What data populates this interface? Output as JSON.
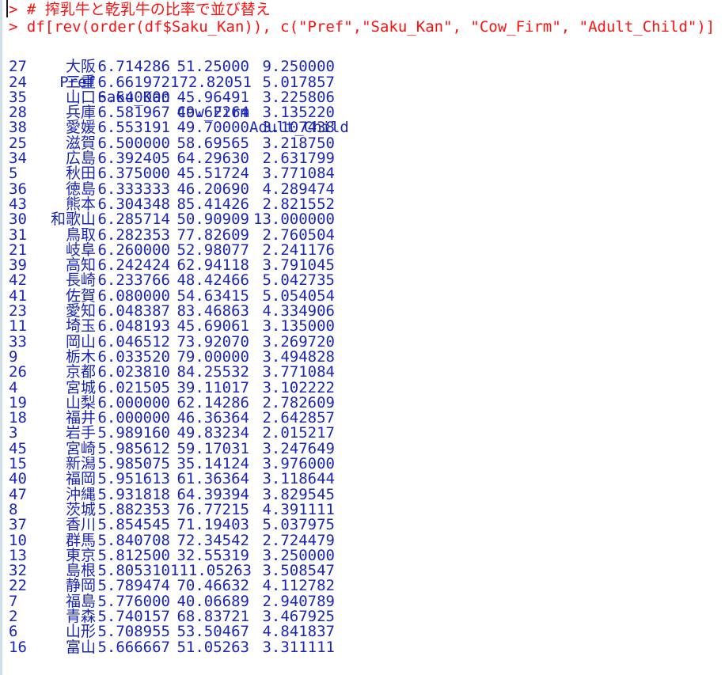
{
  "console": {
    "prompt_symbol": ">",
    "caret_visible": true,
    "colors": {
      "command": "#ff1111",
      "output": "#1a26b8",
      "background": "#ffffff",
      "frame_edge": "#cfe0ea"
    },
    "command_lines": [
      "> # 搾乳牛と乾乳牛の比率で並び替え",
      "> df[rev(order(df$Saku_Kan)), c(\"Pref\",\"Saku_Kan\", \"Cow_Firm\", \"Adult_Child\")]"
    ]
  },
  "table": {
    "columns": [
      "Pref",
      "Saku_Kan",
      "Cow_Firm",
      "Adult_Child"
    ],
    "rows": [
      {
        "idx": "27",
        "pref": "大阪",
        "saku": "6.714286",
        "cow": "51.25000",
        "ac": "9.250000"
      },
      {
        "idx": "24",
        "pref": "三重",
        "saku": "6.661972",
        "cow": "172.82051",
        "ac": "5.017857"
      },
      {
        "idx": "35",
        "pref": "山口",
        "saku": "6.640000",
        "cow": "45.96491",
        "ac": "3.225806"
      },
      {
        "idx": "28",
        "pref": "兵庫",
        "saku": "6.581967",
        "cow": "49.62264",
        "ac": "3.135220"
      },
      {
        "idx": "38",
        "pref": "愛媛",
        "saku": "6.553191",
        "cow": "49.70000",
        "ac": "3.107438"
      },
      {
        "idx": "25",
        "pref": "滋賀",
        "saku": "6.500000",
        "cow": "58.69565",
        "ac": "3.218750"
      },
      {
        "idx": "34",
        "pref": "広島",
        "saku": "6.392405",
        "cow": "64.29630",
        "ac": "2.631799"
      },
      {
        "idx": "5",
        "pref": "秋田",
        "saku": "6.375000",
        "cow": "45.51724",
        "ac": "3.771084"
      },
      {
        "idx": "36",
        "pref": "徳島",
        "saku": "6.333333",
        "cow": "46.20690",
        "ac": "4.289474"
      },
      {
        "idx": "43",
        "pref": "熊本",
        "saku": "6.304348",
        "cow": "85.41426",
        "ac": "2.821552"
      },
      {
        "idx": "30",
        "pref": "和歌山",
        "saku": "6.285714",
        "cow": "50.90909",
        "ac": "13.000000"
      },
      {
        "idx": "31",
        "pref": "鳥取",
        "saku": "6.282353",
        "cow": "77.82609",
        "ac": "2.760504"
      },
      {
        "idx": "21",
        "pref": "岐阜",
        "saku": "6.260000",
        "cow": "52.98077",
        "ac": "2.241176"
      },
      {
        "idx": "39",
        "pref": "高知",
        "saku": "6.242424",
        "cow": "62.94118",
        "ac": "3.791045"
      },
      {
        "idx": "42",
        "pref": "長崎",
        "saku": "6.233766",
        "cow": "48.42466",
        "ac": "5.042735"
      },
      {
        "idx": "41",
        "pref": "佐賀",
        "saku": "6.080000",
        "cow": "54.63415",
        "ac": "5.054054"
      },
      {
        "idx": "23",
        "pref": "愛知",
        "saku": "6.048387",
        "cow": "83.46863",
        "ac": "4.334906"
      },
      {
        "idx": "11",
        "pref": "埼玉",
        "saku": "6.048193",
        "cow": "45.69061",
        "ac": "3.135000"
      },
      {
        "idx": "33",
        "pref": "岡山",
        "saku": "6.046512",
        "cow": "73.92070",
        "ac": "3.269720"
      },
      {
        "idx": "9",
        "pref": "栃木",
        "saku": "6.033520",
        "cow": "79.00000",
        "ac": "3.494828"
      },
      {
        "idx": "26",
        "pref": "京都",
        "saku": "6.023810",
        "cow": "84.25532",
        "ac": "3.771084"
      },
      {
        "idx": "4",
        "pref": "宮城",
        "saku": "6.021505",
        "cow": "39.11017",
        "ac": "3.102222"
      },
      {
        "idx": "19",
        "pref": "山梨",
        "saku": "6.000000",
        "cow": "62.14286",
        "ac": "2.782609"
      },
      {
        "idx": "18",
        "pref": "福井",
        "saku": "6.000000",
        "cow": "46.36364",
        "ac": "2.642857"
      },
      {
        "idx": "3",
        "pref": "岩手",
        "saku": "5.989160",
        "cow": "49.83234",
        "ac": "2.015217"
      },
      {
        "idx": "45",
        "pref": "宮崎",
        "saku": "5.985612",
        "cow": "59.17031",
        "ac": "3.247649"
      },
      {
        "idx": "15",
        "pref": "新潟",
        "saku": "5.985075",
        "cow": "35.14124",
        "ac": "3.976000"
      },
      {
        "idx": "40",
        "pref": "福岡",
        "saku": "5.951613",
        "cow": "61.36364",
        "ac": "3.118644"
      },
      {
        "idx": "47",
        "pref": "沖縄",
        "saku": "5.931818",
        "cow": "64.39394",
        "ac": "3.829545"
      },
      {
        "idx": "8",
        "pref": "茨城",
        "saku": "5.882353",
        "cow": "76.77215",
        "ac": "4.391111"
      },
      {
        "idx": "37",
        "pref": "香川",
        "saku": "5.854545",
        "cow": "71.19403",
        "ac": "5.037975"
      },
      {
        "idx": "10",
        "pref": "群馬",
        "saku": "5.840708",
        "cow": "72.34542",
        "ac": "2.724479"
      },
      {
        "idx": "13",
        "pref": "東京",
        "saku": "5.812500",
        "cow": "32.55319",
        "ac": "3.250000"
      },
      {
        "idx": "32",
        "pref": "島根",
        "saku": "5.805310",
        "cow": "111.05263",
        "ac": "3.508547"
      },
      {
        "idx": "22",
        "pref": "静岡",
        "saku": "5.789474",
        "cow": "70.46632",
        "ac": "4.112782"
      },
      {
        "idx": "7",
        "pref": "福島",
        "saku": "5.776000",
        "cow": "40.06689",
        "ac": "2.940789"
      },
      {
        "idx": "2",
        "pref": "青森",
        "saku": "5.740157",
        "cow": "68.83721",
        "ac": "3.467925"
      },
      {
        "idx": "6",
        "pref": "山形",
        "saku": "5.708955",
        "cow": "53.50467",
        "ac": "4.841837"
      },
      {
        "idx": "16",
        "pref": "富山",
        "saku": "5.666667",
        "cow": "51.05263",
        "ac": "3.311111"
      }
    ]
  }
}
